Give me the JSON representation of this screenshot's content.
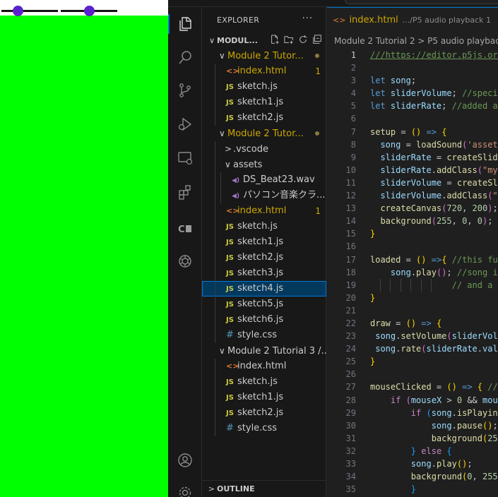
{
  "preview": {
    "slider_rate": {
      "value": 0.25
    },
    "slider_volume": {
      "value": 0.5
    },
    "canvas_color": "#00ff00"
  },
  "activity_bar": {
    "items": [
      {
        "icon": "files-icon"
      },
      {
        "icon": "search-icon"
      },
      {
        "icon": "source-control-icon"
      },
      {
        "icon": "run-debug-icon"
      },
      {
        "icon": "remote-explorer-icon"
      },
      {
        "icon": "extensions-icon"
      },
      {
        "icon": "copilot-ce-icon",
        "text": "C"
      },
      {
        "icon": "openai-icon"
      }
    ],
    "bottom": [
      {
        "icon": "account-icon"
      },
      {
        "icon": "settings-gear-icon"
      }
    ]
  },
  "sidebar": {
    "title": "EXPLORER",
    "more": "···",
    "workspace": "MODUL...",
    "outline": "OUTLINE",
    "tree": [
      {
        "depth": 0,
        "chev": "∨",
        "label": "Module 2 Tutor...",
        "mod": true,
        "dot": true
      },
      {
        "depth": 1,
        "type": "html",
        "icon": "<>",
        "label": "index.html",
        "mod": true,
        "badge": "1"
      },
      {
        "depth": 1,
        "type": "js",
        "icon": "JS",
        "label": "sketch.js"
      },
      {
        "depth": 1,
        "type": "js",
        "icon": "JS",
        "label": "sketch1.js"
      },
      {
        "depth": 1,
        "type": "js",
        "icon": "JS",
        "label": "sketch2.js"
      },
      {
        "depth": 0,
        "chev": "∨",
        "label": "Module 2 Tutor...",
        "mod": true,
        "dot": true
      },
      {
        "depth": 1,
        "chev": ">",
        "label": ".vscode"
      },
      {
        "depth": 1,
        "chev": "∨",
        "label": "assets"
      },
      {
        "depth": 2,
        "type": "audio",
        "icon": "◀)",
        "label": "DS_Beat23.wav"
      },
      {
        "depth": 2,
        "type": "audio",
        "icon": "◀)",
        "label": "パソコン音楽クラ..."
      },
      {
        "depth": 1,
        "type": "html",
        "icon": "<>",
        "label": "index.html",
        "mod": true,
        "badge": "1"
      },
      {
        "depth": 1,
        "type": "js",
        "icon": "JS",
        "label": "sketch.js"
      },
      {
        "depth": 1,
        "type": "js",
        "icon": "JS",
        "label": "sketch1.js"
      },
      {
        "depth": 1,
        "type": "js",
        "icon": "JS",
        "label": "sketch2.js"
      },
      {
        "depth": 1,
        "type": "js",
        "icon": "JS",
        "label": "sketch3.js"
      },
      {
        "depth": 1,
        "type": "js",
        "icon": "JS",
        "label": "sketch4.js",
        "selected": true
      },
      {
        "depth": 1,
        "type": "js",
        "icon": "JS",
        "label": "sketch5.js"
      },
      {
        "depth": 1,
        "type": "js",
        "icon": "JS",
        "label": "sketch6.js"
      },
      {
        "depth": 1,
        "type": "css",
        "icon": "#",
        "label": "style.css"
      },
      {
        "depth": 0,
        "chev": "∨",
        "label": "Module 2 Tutorial 3 /..."
      },
      {
        "depth": 1,
        "type": "html",
        "icon": "<>",
        "label": "index.html"
      },
      {
        "depth": 1,
        "type": "js",
        "icon": "JS",
        "label": "sketch.js"
      },
      {
        "depth": 1,
        "type": "js",
        "icon": "JS",
        "label": "sketch1.js"
      },
      {
        "depth": 1,
        "type": "js",
        "icon": "JS",
        "label": "sketch2.js"
      },
      {
        "depth": 1,
        "type": "css",
        "icon": "#",
        "label": "style.css"
      }
    ]
  },
  "editor": {
    "tab": {
      "icon": "<>",
      "name": "index.html",
      "path": ".../P5 audio playback 1"
    },
    "breadcrumb": "Module 2 Tutorial 2 > P5 audio playback",
    "current_line": 1,
    "lines": [
      {
        "n": "1",
        "t": [
          [
            "cmu",
            "///https://editor.p5js.org"
          ]
        ]
      },
      {
        "n": "2",
        "t": []
      },
      {
        "n": "3",
        "t": [
          [
            "kw",
            "let "
          ],
          [
            "var",
            "song"
          ],
          [
            "p",
            ";"
          ]
        ]
      },
      {
        "n": "4",
        "t": [
          [
            "kw",
            "let "
          ],
          [
            "var",
            "sliderVolume"
          ],
          [
            "p",
            "; "
          ],
          [
            "cm",
            "//speci"
          ]
        ]
      },
      {
        "n": "5",
        "t": [
          [
            "kw",
            "let "
          ],
          [
            "var",
            "sliderRate"
          ],
          [
            "p",
            "; "
          ],
          [
            "cm",
            "//added a"
          ]
        ]
      },
      {
        "n": "6",
        "t": []
      },
      {
        "n": "7",
        "t": [
          [
            "fn",
            "setup"
          ],
          [
            "p",
            " = "
          ],
          [
            "br",
            "("
          ],
          [
            "br",
            ")"
          ],
          [
            "p",
            " "
          ],
          [
            "kw",
            "=>"
          ],
          [
            "p",
            " "
          ],
          [
            "br",
            "{"
          ]
        ]
      },
      {
        "n": "8",
        "t": [
          [
            "p",
            "  "
          ],
          [
            "var",
            "song"
          ],
          [
            "p",
            " = "
          ],
          [
            "fn",
            "loadSound"
          ],
          [
            "br2",
            "("
          ],
          [
            "str",
            "'asset"
          ]
        ]
      },
      {
        "n": "9",
        "t": [
          [
            "p",
            "  "
          ],
          [
            "var",
            "sliderRate"
          ],
          [
            "p",
            " = "
          ],
          [
            "fn",
            "createSlid"
          ]
        ]
      },
      {
        "n": "10",
        "t": [
          [
            "p",
            "  "
          ],
          [
            "var",
            "sliderRate"
          ],
          [
            "p",
            "."
          ],
          [
            "fn",
            "addClass"
          ],
          [
            "br2",
            "("
          ],
          [
            "str",
            "\"my"
          ]
        ]
      },
      {
        "n": "11",
        "t": [
          [
            "p",
            "  "
          ],
          [
            "var",
            "sliderVolume"
          ],
          [
            "p",
            " = "
          ],
          [
            "fn",
            "createSl"
          ]
        ]
      },
      {
        "n": "12",
        "t": [
          [
            "p",
            "  "
          ],
          [
            "var",
            "sliderVolume"
          ],
          [
            "p",
            "."
          ],
          [
            "fn",
            "addClass"
          ],
          [
            "br2",
            "("
          ],
          [
            "str",
            "\""
          ]
        ]
      },
      {
        "n": "13",
        "t": [
          [
            "p",
            "  "
          ],
          [
            "fn",
            "createCanvas"
          ],
          [
            "br2",
            "("
          ],
          [
            "num",
            "720"
          ],
          [
            "p",
            ", "
          ],
          [
            "num",
            "200"
          ],
          [
            "br2",
            ")"
          ],
          [
            "p",
            ";"
          ]
        ]
      },
      {
        "n": "14",
        "t": [
          [
            "p",
            "  "
          ],
          [
            "fn",
            "background"
          ],
          [
            "br2",
            "("
          ],
          [
            "num",
            "255"
          ],
          [
            "p",
            ", "
          ],
          [
            "num",
            "0"
          ],
          [
            "p",
            ", "
          ],
          [
            "num",
            "0"
          ],
          [
            "br2",
            ")"
          ],
          [
            "p",
            ";"
          ]
        ]
      },
      {
        "n": "15",
        "t": [
          [
            "br",
            "}"
          ]
        ]
      },
      {
        "n": "16",
        "t": []
      },
      {
        "n": "17",
        "t": [
          [
            "fn",
            "loaded"
          ],
          [
            "p",
            " = "
          ],
          [
            "br",
            "("
          ],
          [
            "br",
            ")"
          ],
          [
            "p",
            " "
          ],
          [
            "kw",
            "=>"
          ],
          [
            "br",
            "{"
          ],
          [
            "p",
            " "
          ],
          [
            "cm",
            "//this fu"
          ]
        ]
      },
      {
        "n": "18",
        "t": [
          [
            "p",
            "    "
          ],
          [
            "var",
            "song"
          ],
          [
            "p",
            "."
          ],
          [
            "fn",
            "play"
          ],
          [
            "br2",
            "("
          ],
          [
            "br2",
            ")"
          ],
          [
            "p",
            "; "
          ],
          [
            "cm",
            "//song i"
          ]
        ]
      },
      {
        "n": "19",
        "t": [
          [
            "p",
            "                "
          ],
          [
            "cm",
            "// and a"
          ]
        ],
        "guides": 6
      },
      {
        "n": "20",
        "t": [
          [
            "br",
            "}"
          ]
        ]
      },
      {
        "n": "21",
        "t": []
      },
      {
        "n": "22",
        "t": [
          [
            "fn",
            "draw"
          ],
          [
            "p",
            " = "
          ],
          [
            "br",
            "("
          ],
          [
            "br",
            ")"
          ],
          [
            "p",
            " "
          ],
          [
            "kw",
            "=>"
          ],
          [
            "p",
            " "
          ],
          [
            "br",
            "{"
          ]
        ]
      },
      {
        "n": "23",
        "t": [
          [
            "p",
            " "
          ],
          [
            "var",
            "song"
          ],
          [
            "p",
            "."
          ],
          [
            "fn",
            "setVolume"
          ],
          [
            "br2",
            "("
          ],
          [
            "var",
            "sliderVol"
          ]
        ]
      },
      {
        "n": "24",
        "t": [
          [
            "p",
            " "
          ],
          [
            "var",
            "song"
          ],
          [
            "p",
            "."
          ],
          [
            "fn",
            "rate"
          ],
          [
            "br2",
            "("
          ],
          [
            "var",
            "sliderRate"
          ],
          [
            "p",
            "."
          ],
          [
            "var",
            "val"
          ]
        ]
      },
      {
        "n": "25",
        "t": [
          [
            "br",
            "}"
          ]
        ]
      },
      {
        "n": "26",
        "t": []
      },
      {
        "n": "27",
        "t": [
          [
            "fn",
            "mouseClicked"
          ],
          [
            "p",
            " = "
          ],
          [
            "br",
            "("
          ],
          [
            "br",
            ")"
          ],
          [
            "p",
            " "
          ],
          [
            "kw",
            "=>"
          ],
          [
            "p",
            " "
          ],
          [
            "br",
            "{"
          ],
          [
            "p",
            " "
          ],
          [
            "cm",
            "//"
          ]
        ]
      },
      {
        "n": "28",
        "t": [
          [
            "p",
            "    "
          ],
          [
            "ctl",
            "if"
          ],
          [
            "p",
            " "
          ],
          [
            "br2",
            "("
          ],
          [
            "var",
            "mouseX"
          ],
          [
            "p",
            " > "
          ],
          [
            "num",
            "0"
          ],
          [
            "p",
            " && "
          ],
          [
            "var",
            "mou"
          ]
        ]
      },
      {
        "n": "29",
        "t": [
          [
            "p",
            "        "
          ],
          [
            "ctl",
            "if"
          ],
          [
            "p",
            " "
          ],
          [
            "br3",
            "("
          ],
          [
            "var",
            "song"
          ],
          [
            "p",
            "."
          ],
          [
            "fn",
            "isPlayin"
          ]
        ]
      },
      {
        "n": "30",
        "t": [
          [
            "p",
            "            "
          ],
          [
            "var",
            "song"
          ],
          [
            "p",
            "."
          ],
          [
            "fn",
            "pause"
          ],
          [
            "br",
            "("
          ],
          [
            "br",
            ")"
          ],
          [
            "p",
            ";"
          ]
        ]
      },
      {
        "n": "31",
        "t": [
          [
            "p",
            "            "
          ],
          [
            "fn",
            "background"
          ],
          [
            "br",
            "("
          ],
          [
            "num",
            "25"
          ]
        ]
      },
      {
        "n": "32",
        "t": [
          [
            "p",
            "        "
          ],
          [
            "br3",
            "}"
          ],
          [
            "p",
            " "
          ],
          [
            "ctl",
            "else"
          ],
          [
            "p",
            " "
          ],
          [
            "br3",
            "{"
          ]
        ]
      },
      {
        "n": "33",
        "t": [
          [
            "p",
            "        "
          ],
          [
            "var",
            "song"
          ],
          [
            "p",
            "."
          ],
          [
            "fn",
            "play"
          ],
          [
            "br",
            "("
          ],
          [
            "br",
            ")"
          ],
          [
            "p",
            ";"
          ]
        ]
      },
      {
        "n": "34",
        "t": [
          [
            "p",
            "        "
          ],
          [
            "fn",
            "background"
          ],
          [
            "br",
            "("
          ],
          [
            "num",
            "0"
          ],
          [
            "p",
            ", "
          ],
          [
            "num",
            "255"
          ]
        ]
      },
      {
        "n": "35",
        "t": [
          [
            "p",
            "        "
          ],
          [
            "br3",
            "}"
          ]
        ]
      }
    ]
  },
  "colors": {
    "accent": "#0078d4",
    "modified": "#cca700",
    "selection": "#04395e",
    "slider_thumb": "#5a22cc"
  }
}
